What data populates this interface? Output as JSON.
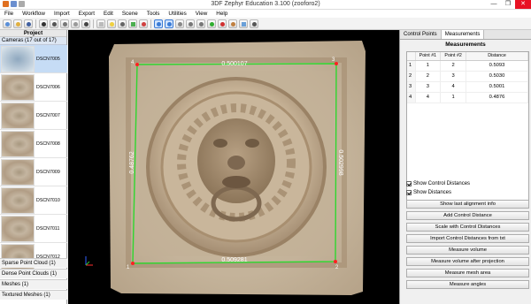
{
  "window": {
    "title": "3DF Zephyr Education 3.100 (zooforo2)",
    "controls": [
      "—",
      "❐",
      "✕"
    ]
  },
  "menu": [
    "File",
    "Workflow",
    "Import",
    "Export",
    "Edit",
    "Scene",
    "Tools",
    "Utilities",
    "View",
    "Help"
  ],
  "project": {
    "title": "Project",
    "cameras_header": "Cameras (17 out of 17)",
    "cameras": [
      "DSCN7005",
      "DSCN7006",
      "DSCN7007",
      "DSCN7008",
      "DSCN7009",
      "DSCN7010",
      "DSCN7011",
      "DSCN7012"
    ],
    "sections": [
      "Sparse Point Cloud (1)",
      "Dense Point Clouds (1)",
      "Meshes (1)",
      "Textured Meshes (1)"
    ]
  },
  "viewport": {
    "corner_labels": [
      "4",
      "3",
      "1",
      "2"
    ],
    "distance_top": "0.500107",
    "distance_bottom": "0.509281",
    "distance_left": "0.48762",
    "distance_right": "0.502998",
    "line_color": "#2fd62f",
    "point_color": "#ff2020"
  },
  "right_panel": {
    "tabs": [
      "Control Points",
      "Measurements"
    ],
    "active_tab": "Measurements",
    "title": "Measurements",
    "table": {
      "columns": [
        "Point #1",
        "Point #2",
        "Distance"
      ],
      "rows": [
        {
          "n": "1",
          "p1": "1",
          "p2": "2",
          "d": "0.5093"
        },
        {
          "n": "2",
          "p1": "2",
          "p2": "3",
          "d": "0.5030"
        },
        {
          "n": "3",
          "p1": "3",
          "p2": "4",
          "d": "0.5001"
        },
        {
          "n": "4",
          "p1": "4",
          "p2": "1",
          "d": "0.4876"
        }
      ]
    },
    "checkboxes": [
      "Show Control Distances",
      "Show Distances"
    ],
    "buttons": [
      "Show last alignment info",
      "Add Control Distance",
      "Scale with Control Distances",
      "Import Control Distances from txt",
      "Measure volume",
      "Measure volume after projection",
      "Measure mesh area",
      "Measure angles"
    ]
  }
}
